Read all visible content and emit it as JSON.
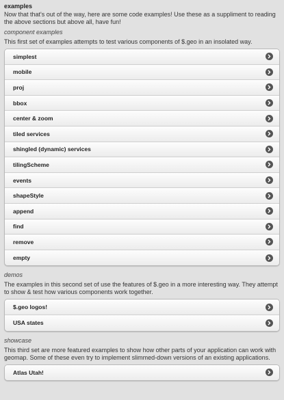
{
  "examples": {
    "title": "examples",
    "intro": "Now that that's out of the way, here are some code examples! Use these as a suppliment to reading the above sections but above all, have fun!"
  },
  "component_examples": {
    "heading": "component examples",
    "description": "This first set of examples attempts to test various components of $.geo in an insolated way.",
    "items": [
      {
        "label": "simplest"
      },
      {
        "label": "mobile"
      },
      {
        "label": "proj"
      },
      {
        "label": "bbox"
      },
      {
        "label": "center & zoom"
      },
      {
        "label": "tiled services"
      },
      {
        "label": "shingled (dynamic) services"
      },
      {
        "label": "tilingScheme"
      },
      {
        "label": "events"
      },
      {
        "label": "shapeStyle"
      },
      {
        "label": "append"
      },
      {
        "label": "find"
      },
      {
        "label": "remove"
      },
      {
        "label": "empty"
      }
    ]
  },
  "demos": {
    "heading": "demos",
    "description": "The examples in this second set of use the features of $.geo in a more interesting way. They attempt to show & test how various components work together.",
    "items": [
      {
        "label": "$.geo logos!"
      },
      {
        "label": "USA states"
      }
    ]
  },
  "showcase": {
    "heading": "showcase",
    "description": "This third set are more featured examples to show how other parts of your application can work with geomap. Some of these even try to implement slimmed-down versions of an existing applications.",
    "items": [
      {
        "label": "Atlas Utah!"
      }
    ]
  },
  "icons": {
    "row_arrow": "chevron-right-circle-icon"
  }
}
